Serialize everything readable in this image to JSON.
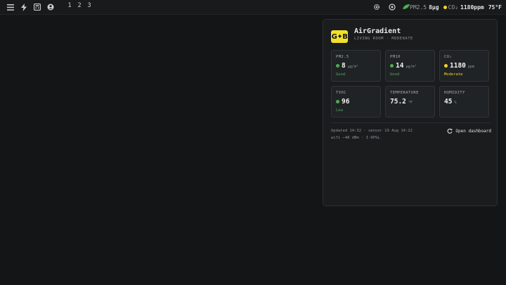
{
  "topbar": {
    "workspaces": [
      "1",
      "2",
      "3"
    ],
    "pm25_label": "PM2.5",
    "pm25_value": "8μg",
    "co2_label": "CO₂",
    "co2_value": "1180ppm",
    "temp": "75°F",
    "co2_dot_color": "#f2d52a"
  },
  "widget": {
    "title": "AirGradient",
    "logo_text": "G✦B",
    "subtitle": "LIVING ROOM · MODERATE",
    "cards": [
      {
        "label": "PM2.5",
        "value": "8",
        "unit": "µg/m³",
        "status": "Good",
        "status_color": "#4caf50"
      },
      {
        "label": "PM10",
        "value": "14",
        "unit": "µg/m³",
        "status": "Good",
        "status_color": "#4caf50"
      },
      {
        "label": "CO₂",
        "value": "1180",
        "unit": "ppm",
        "status": "Moderate",
        "status_color": "#f2d52a"
      },
      {
        "label": "TVOC",
        "value": "96",
        "unit": "",
        "status": "Low",
        "status_color": "#4caf50"
      },
      {
        "label": "TEMPERATURE",
        "value": "75.2",
        "unit": "°F",
        "status": "",
        "status_color": ""
      },
      {
        "label": "HUMIDITY",
        "value": "45",
        "unit": "%",
        "status": "",
        "status_color": ""
      }
    ],
    "footer_line1": "Updated 14:32 · sensor 19 Aug 14:22",
    "footer_line2": "wifi −48 dBm · I-9PSL",
    "dashboard_label": "Open dashboard"
  }
}
